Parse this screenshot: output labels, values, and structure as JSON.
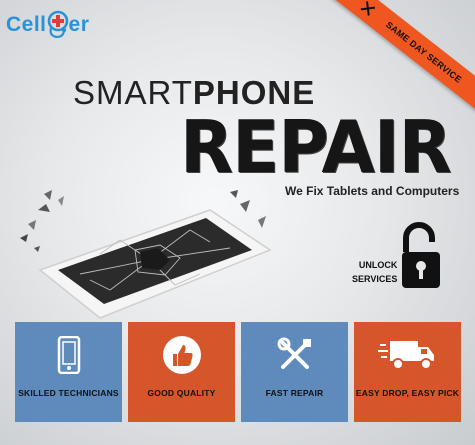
{
  "logo": {
    "prefix": "Cell",
    "suffix": "er"
  },
  "ribbon": {
    "text": "SAME DAY SERVICE",
    "icon": "tools-cross-icon"
  },
  "headline": {
    "part1": "SMART",
    "part2": "PHONE",
    "main": "REPAIR"
  },
  "subheading": "We Fix Tablets and Computers",
  "unlock": {
    "line1": "UNLOCK",
    "line2": "SERVICES",
    "icon": "open-padlock-icon"
  },
  "features": [
    {
      "label": "SKILLED TECHNICIANS",
      "icon": "smartphone-icon",
      "color": "#5e8bbb"
    },
    {
      "label": "GOOD QUALITY",
      "icon": "thumbs-up-icon",
      "color": "#d6562b"
    },
    {
      "label": "FAST REPAIR",
      "icon": "tools-icon",
      "color": "#5e8bbb"
    },
    {
      "label": "EASY DROP, EASY PICK",
      "icon": "delivery-truck-icon",
      "color": "#d6562b"
    }
  ],
  "colors": {
    "brand": "#2a93d5",
    "orange": "#f0561f",
    "blue": "#5e8bbb"
  }
}
